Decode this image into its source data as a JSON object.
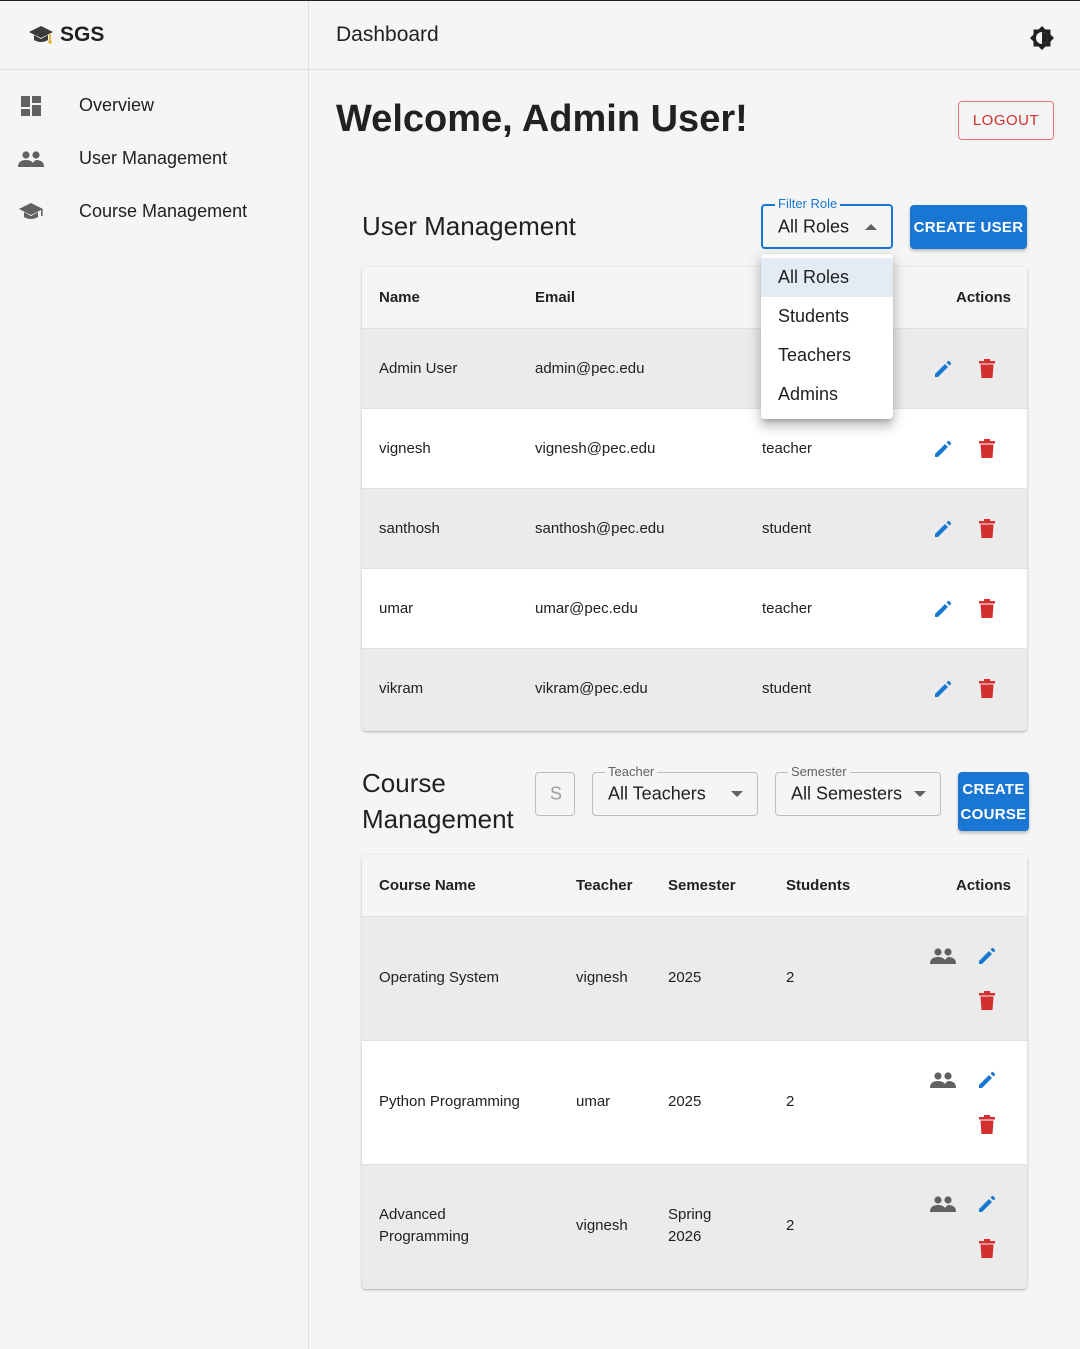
{
  "brand": {
    "name": "SGS",
    "icon": "graduation-cap-icon"
  },
  "sidebar": {
    "items": [
      {
        "label": "Overview",
        "icon": "dashboard-icon"
      },
      {
        "label": "User Management",
        "icon": "people-icon"
      },
      {
        "label": "Course Management",
        "icon": "school-icon"
      }
    ]
  },
  "header": {
    "title": "Dashboard",
    "theme_icon": "brightness-icon"
  },
  "main": {
    "welcome": "Welcome, Admin User!",
    "logout_label": "LOGOUT"
  },
  "users": {
    "title": "User Management",
    "filter": {
      "legend": "Filter Role",
      "value": "All Roles"
    },
    "create_label": "CREATE USER",
    "columns": [
      "Name",
      "Email",
      "",
      "Actions"
    ],
    "rows": [
      {
        "name": "Admin User",
        "email": "admin@pec.edu",
        "role": ""
      },
      {
        "name": "vignesh",
        "email": "vignesh@pec.edu",
        "role": "teacher"
      },
      {
        "name": "santhosh",
        "email": "santhosh@pec.edu",
        "role": "student"
      },
      {
        "name": "umar",
        "email": "umar@pec.edu",
        "role": "teacher"
      },
      {
        "name": "vikram",
        "email": "vikram@pec.edu",
        "role": "student"
      }
    ]
  },
  "role_menu": {
    "options": [
      "All Roles",
      "Students",
      "Teachers",
      "Admins"
    ],
    "selected": "All Roles"
  },
  "courses": {
    "title_line1": "Course",
    "title_line2": "Management",
    "search_placeholder": "S",
    "teacher_filter": {
      "legend": "Teacher",
      "value": "All Teachers"
    },
    "semester_filter": {
      "legend": "Semester",
      "value": "All Semesters"
    },
    "create_line1": "CREATE",
    "create_line2": "COURSE",
    "columns": [
      "Course Name",
      "Teacher",
      "Semester",
      "Students",
      "Actions"
    ],
    "rows": [
      {
        "name_line1": "Operating System",
        "name_line2": "",
        "teacher": "vignesh",
        "semester_line1": "2025",
        "semester_line2": "",
        "students": "2"
      },
      {
        "name_line1": "Python Programming",
        "name_line2": "",
        "teacher": "umar",
        "semester_line1": "2025",
        "semester_line2": "",
        "students": "2"
      },
      {
        "name_line1": "Advanced",
        "name_line2": "Programming",
        "teacher": "vignesh",
        "semester_line1": "Spring",
        "semester_line2": "2026",
        "students": "2"
      }
    ]
  },
  "colors": {
    "primary": "#1976d2",
    "danger": "#d32f2f",
    "icon_gray": "#616161"
  }
}
